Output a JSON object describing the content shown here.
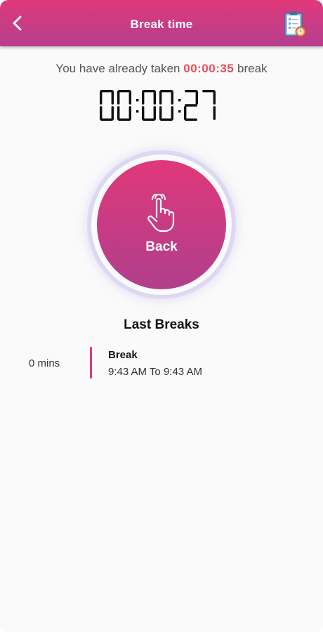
{
  "header": {
    "title": "Break time",
    "back_icon": "chevron-left-icon",
    "report_icon": "clipboard-clock-icon"
  },
  "summary": {
    "prefix": "You have already taken",
    "taken": "00:00:35",
    "suffix": "break"
  },
  "timer": {
    "display": "00:00:27"
  },
  "action": {
    "label": "Back",
    "icon": "hand-pointer-icon"
  },
  "last_breaks": {
    "title": "Last Breaks",
    "items": [
      {
        "duration": "0 mins",
        "type": "Break",
        "range": "9:43 AM To 9:43 AM"
      }
    ]
  },
  "colors": {
    "brand_top": "#e0387a",
    "brand_bottom": "#b03f8c",
    "highlight": "#ef4a5b"
  }
}
